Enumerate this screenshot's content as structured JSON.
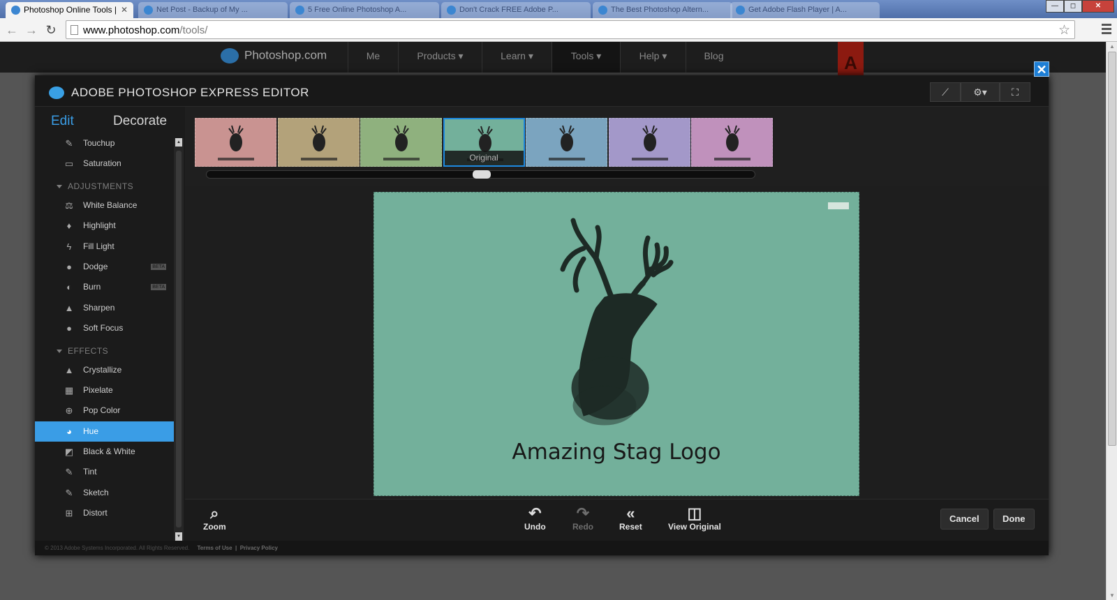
{
  "browser": {
    "tabs": [
      {
        "title": "Photoshop Online Tools |",
        "active": true
      },
      {
        "title": "Net Post - Backup of My ...",
        "active": false
      },
      {
        "title": "5 Free Online Photoshop A...",
        "active": false
      },
      {
        "title": "Don't Crack FREE Adobe P...",
        "active": false
      },
      {
        "title": "The Best Photoshop Altern...",
        "active": false
      },
      {
        "title": "Get Adobe Flash Player | A...",
        "active": false
      }
    ],
    "tab_close": "✕",
    "window_buttons": {
      "minimize": "—",
      "maximize": "◻",
      "close": "✕"
    },
    "url_domain": "www.photoshop.com",
    "url_path": "/tools/"
  },
  "site_nav": {
    "logo_text": "Photoshop.com",
    "items": [
      "Me",
      "Products ▾",
      "Learn ▾",
      "Tools ▾",
      "Help ▾",
      "Blog"
    ],
    "adobe_logo": "A"
  },
  "editor": {
    "title": "ADOBE PHOTOSHOP EXPRESS EDITOR",
    "close_label": "✕",
    "header_buttons": {
      "brush": "⟋",
      "settings": "⚙▾",
      "fullscreen": "⛶"
    },
    "tabs": {
      "edit": "Edit",
      "decorate": "Decorate"
    },
    "tools_top": [
      {
        "label": "Touchup",
        "icon": "bandage-icon",
        "glyph": "✎"
      },
      {
        "label": "Saturation",
        "icon": "saturation-icon",
        "glyph": "▭"
      }
    ],
    "adjustments_header": "ADJUSTMENTS",
    "adjustments": [
      {
        "label": "White Balance",
        "icon": "scale-icon",
        "glyph": "⚖"
      },
      {
        "label": "Highlight",
        "icon": "bulb-icon",
        "glyph": "♦"
      },
      {
        "label": "Fill Light",
        "icon": "bolt-icon",
        "glyph": "ϟ"
      },
      {
        "label": "Dodge",
        "icon": "magnifier-icon",
        "glyph": "●",
        "badge": "BETA"
      },
      {
        "label": "Burn",
        "icon": "burn-icon",
        "glyph": "◐",
        "badge": "BETA"
      },
      {
        "label": "Sharpen",
        "icon": "triangle-icon",
        "glyph": "▲"
      },
      {
        "label": "Soft Focus",
        "icon": "drop-icon",
        "glyph": "●"
      }
    ],
    "effects_header": "EFFECTS",
    "effects": [
      {
        "label": "Crystallize",
        "icon": "crystal-icon",
        "glyph": "▲"
      },
      {
        "label": "Pixelate",
        "icon": "grid-icon",
        "glyph": "▦"
      },
      {
        "label": "Pop Color",
        "icon": "target-icon",
        "glyph": "⊕"
      },
      {
        "label": "Hue",
        "icon": "palette-icon",
        "glyph": "◕",
        "selected": true
      },
      {
        "label": "Black & White",
        "icon": "bw-icon",
        "glyph": "◩"
      },
      {
        "label": "Tint",
        "icon": "dropper-icon",
        "glyph": "✎"
      },
      {
        "label": "Sketch",
        "icon": "pencil-icon",
        "glyph": "✎"
      },
      {
        "label": "Distort",
        "icon": "distort-icon",
        "glyph": "⊞"
      }
    ],
    "filmstrip": [
      {
        "color": "#c99391"
      },
      {
        "color": "#b3a27a"
      },
      {
        "color": "#8fb17e"
      },
      {
        "color": "#73b09b",
        "label": "Original",
        "selected": true
      },
      {
        "color": "#7ba4bf"
      },
      {
        "color": "#a398c9"
      },
      {
        "color": "#c091bc"
      }
    ],
    "photo": {
      "caption": "Amazing Stag Logo",
      "bg": "#73b09b"
    },
    "bottom_buttons": {
      "zoom": "Zoom",
      "undo": "Undo",
      "redo": "Redo",
      "reset": "Reset",
      "view_original": "View Original",
      "cancel": "Cancel",
      "done": "Done"
    },
    "footer": {
      "copyright": "© 2013 Adobe Systems Incorporated. All Rights Reserved.",
      "terms": "Terms of Use",
      "sep": "|",
      "privacy": "Privacy Policy"
    }
  },
  "colors": {
    "accent": "#3a9de6",
    "editor_bg": "#181818",
    "photo_bg": "#73b09b"
  }
}
